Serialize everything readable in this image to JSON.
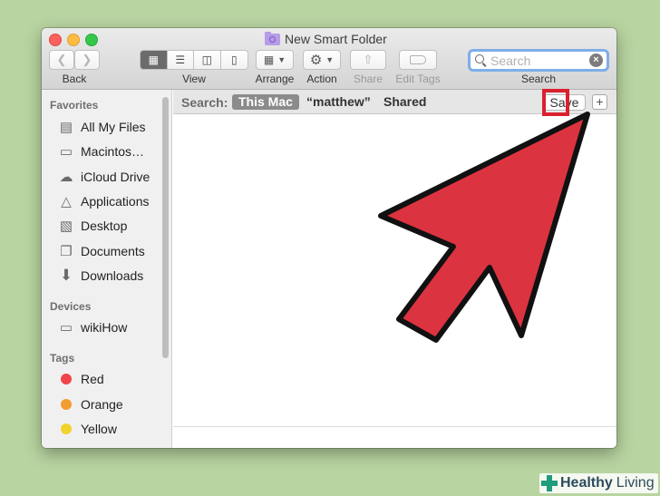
{
  "window": {
    "title": "New Smart Folder"
  },
  "toolbar": {
    "back_label": "Back",
    "view_label": "View",
    "arrange_label": "Arrange",
    "action_label": "Action",
    "share_label": "Share",
    "edit_tags_label": "Edit Tags",
    "search_label": "Search"
  },
  "search": {
    "placeholder": "Search",
    "value": ""
  },
  "sidebar": {
    "favorites_heading": "Favorites",
    "favorites": [
      {
        "label": "All My Files",
        "icon": "all-files-icon"
      },
      {
        "label": "Macintos…",
        "icon": "hard-drive-icon"
      },
      {
        "label": "iCloud Drive",
        "icon": "cloud-icon"
      },
      {
        "label": "Applications",
        "icon": "applications-icon"
      },
      {
        "label": "Desktop",
        "icon": "desktop-icon"
      },
      {
        "label": "Documents",
        "icon": "documents-icon"
      },
      {
        "label": "Downloads",
        "icon": "download-icon"
      }
    ],
    "devices_heading": "Devices",
    "devices": [
      {
        "label": "wikiHow",
        "icon": "hard-drive-icon"
      }
    ],
    "tags_heading": "Tags",
    "tags": [
      {
        "label": "Red",
        "color": "#f2454b"
      },
      {
        "label": "Orange",
        "color": "#f39c2f"
      },
      {
        "label": "Yellow",
        "color": "#f2d22d"
      }
    ]
  },
  "searchbar": {
    "label": "Search:",
    "scopes": [
      "This Mac",
      "“matthew”",
      "Shared"
    ],
    "selected_scope": "This Mac",
    "save_label": "Save",
    "add_label": "+"
  },
  "annotation": {
    "arrow_color": "#dc3340",
    "highlight_color": "#d9212f"
  },
  "watermark": {
    "brand_a": "Healthy",
    "brand_b": "Living"
  }
}
